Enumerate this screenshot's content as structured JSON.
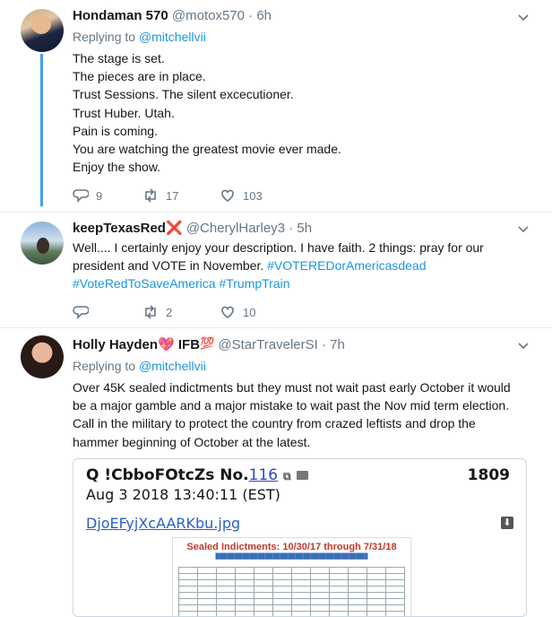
{
  "tweets": [
    {
      "name": "Hondaman 570",
      "handle": "@motox570",
      "time": "6h",
      "replying_prefix": "Replying to",
      "replying_to": "@mitchellvii",
      "lines": [
        "The stage is set.",
        "The pieces are in place.",
        "Trust Sessions. The silent excecutioner.",
        "Trust Huber. Utah.",
        "Pain is coming.",
        "You are watching the greatest movie ever made.",
        "Enjoy the show."
      ],
      "replies": "9",
      "retweets": "17",
      "likes": "103"
    },
    {
      "name": "keepTexasRed",
      "name_emoji": "❌",
      "handle": "@CherylHarley3",
      "time": "5h",
      "line1": "Well.... I certainly enjoy your description. I have faith. 2 things: pray for our",
      "line2_text": "president and VOTE in November. ",
      "line2_tag": "#VOTEREDorAmericasdead",
      "line3_tag1": "#VoteRedToSaveAmerica",
      "line3_tag2": "#TrumpTrain",
      "replies": "",
      "retweets": "2",
      "likes": "10"
    },
    {
      "name": "Holly Hayden",
      "name_emoji": "💖",
      "name_suffix": "IFB",
      "name_emoji2": "💯",
      "handle": "@StarTravelerSI",
      "time": "7h",
      "replying_prefix": "Replying to",
      "replying_to": "@mitchellvii",
      "lines": [
        "Over 45K sealed indictments but they must not wait past early October it would",
        "be a major gamble and a major mistake to wait past the Nov mid term election.",
        "Call in the military to protect the country from crazed leftists and drop the",
        "hammer beginning of October at the latest."
      ]
    }
  ],
  "card": {
    "title_prefix": "Q !CbboFOtcZs No.",
    "post_number": "116",
    "count": "1809",
    "date": "Aug 3 2018 13:40:11 (EST)",
    "filename": "DjoEFyjXcAARKbu.jpg",
    "image_title": "Sealed Indictments: 10/30/17 through 7/31/18"
  },
  "dot": "·"
}
